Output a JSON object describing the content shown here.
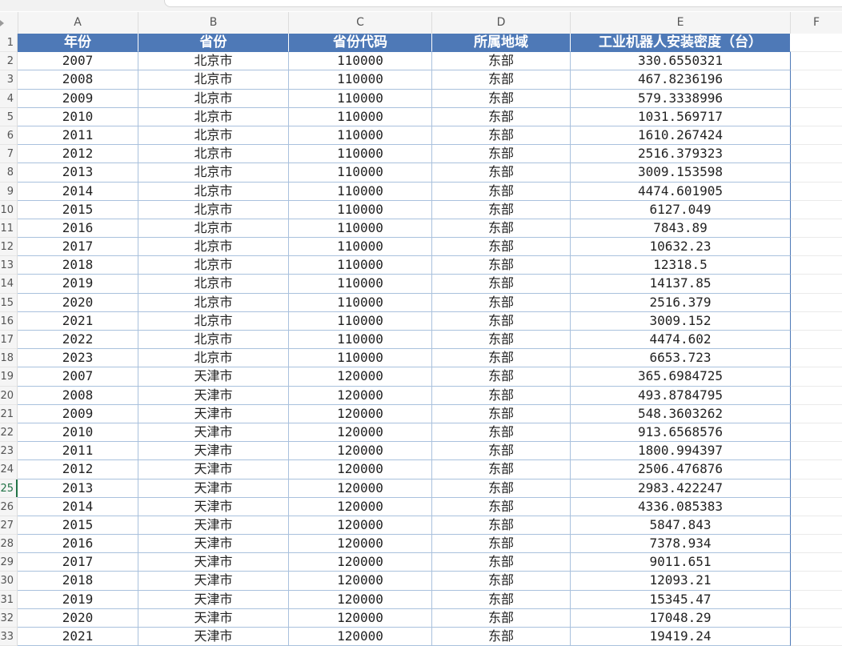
{
  "columns": [
    "A",
    "B",
    "C",
    "D",
    "E",
    "F"
  ],
  "header": [
    "年份",
    "省份",
    "省份代码",
    "所属地域",
    "工业机器人安装密度（台）"
  ],
  "row_numbers": [
    "1",
    "2",
    "3",
    "4",
    "5",
    "6",
    "7",
    "8",
    "9",
    "10",
    "11",
    "12",
    "13",
    "14",
    "15",
    "16",
    "17",
    "18",
    "19",
    "20",
    "21",
    "22",
    "23",
    "24",
    "25",
    "26",
    "27",
    "28",
    "29",
    "30",
    "31",
    "32",
    "33"
  ],
  "active_row_number": "25",
  "rows": [
    [
      "2007",
      "北京市",
      "110000",
      "东部",
      "330.6550321"
    ],
    [
      "2008",
      "北京市",
      "110000",
      "东部",
      "467.8236196"
    ],
    [
      "2009",
      "北京市",
      "110000",
      "东部",
      "579.3338996"
    ],
    [
      "2010",
      "北京市",
      "110000",
      "东部",
      "1031.569717"
    ],
    [
      "2011",
      "北京市",
      "110000",
      "东部",
      "1610.267424"
    ],
    [
      "2012",
      "北京市",
      "110000",
      "东部",
      "2516.379323"
    ],
    [
      "2013",
      "北京市",
      "110000",
      "东部",
      "3009.153598"
    ],
    [
      "2014",
      "北京市",
      "110000",
      "东部",
      "4474.601905"
    ],
    [
      "2015",
      "北京市",
      "110000",
      "东部",
      "6127.049"
    ],
    [
      "2016",
      "北京市",
      "110000",
      "东部",
      "7843.89"
    ],
    [
      "2017",
      "北京市",
      "110000",
      "东部",
      "10632.23"
    ],
    [
      "2018",
      "北京市",
      "110000",
      "东部",
      "12318.5"
    ],
    [
      "2019",
      "北京市",
      "110000",
      "东部",
      "14137.85"
    ],
    [
      "2020",
      "北京市",
      "110000",
      "东部",
      "2516.379"
    ],
    [
      "2021",
      "北京市",
      "110000",
      "东部",
      "3009.152"
    ],
    [
      "2022",
      "北京市",
      "110000",
      "东部",
      "4474.602"
    ],
    [
      "2023",
      "北京市",
      "110000",
      "东部",
      "6653.723"
    ],
    [
      "2007",
      "天津市",
      "120000",
      "东部",
      "365.6984725"
    ],
    [
      "2008",
      "天津市",
      "120000",
      "东部",
      "493.8784795"
    ],
    [
      "2009",
      "天津市",
      "120000",
      "东部",
      "548.3603262"
    ],
    [
      "2010",
      "天津市",
      "120000",
      "东部",
      "913.6568576"
    ],
    [
      "2011",
      "天津市",
      "120000",
      "东部",
      "1800.994397"
    ],
    [
      "2012",
      "天津市",
      "120000",
      "东部",
      "2506.476876"
    ],
    [
      "2013",
      "天津市",
      "120000",
      "东部",
      "2983.422247"
    ],
    [
      "2014",
      "天津市",
      "120000",
      "东部",
      "4336.085383"
    ],
    [
      "2015",
      "天津市",
      "120000",
      "东部",
      "5847.843"
    ],
    [
      "2016",
      "天津市",
      "120000",
      "东部",
      "7378.934"
    ],
    [
      "2017",
      "天津市",
      "120000",
      "东部",
      "9011.651"
    ],
    [
      "2018",
      "天津市",
      "120000",
      "东部",
      "12093.21"
    ],
    [
      "2019",
      "天津市",
      "120000",
      "东部",
      "15345.47"
    ],
    [
      "2020",
      "天津市",
      "120000",
      "东部",
      "17048.29"
    ],
    [
      "2021",
      "天津市",
      "120000",
      "东部",
      "19419.24"
    ]
  ]
}
